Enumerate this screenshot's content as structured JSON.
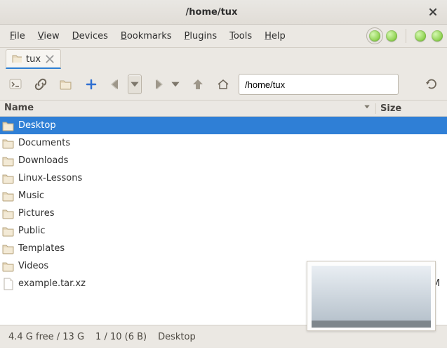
{
  "window": {
    "title": "/home/tux"
  },
  "menu": {
    "file": "File",
    "view": "View",
    "devices": "Devices",
    "bookmarks": "Bookmarks",
    "plugins": "Plugins",
    "tools": "Tools",
    "help": "Help"
  },
  "tab": {
    "label": "tux"
  },
  "path": {
    "value": "/home/tux"
  },
  "columns": {
    "name": "Name",
    "size": "Size"
  },
  "files": [
    {
      "name": "Desktop",
      "type": "folder",
      "size": "",
      "selected": true
    },
    {
      "name": "Documents",
      "type": "folder",
      "size": "",
      "selected": false
    },
    {
      "name": "Downloads",
      "type": "folder",
      "size": "",
      "selected": false
    },
    {
      "name": "Linux-Lessons",
      "type": "folder",
      "size": "",
      "selected": false
    },
    {
      "name": "Music",
      "type": "folder",
      "size": "",
      "selected": false
    },
    {
      "name": "Pictures",
      "type": "folder",
      "size": "",
      "selected": false
    },
    {
      "name": "Public",
      "type": "folder",
      "size": "",
      "selected": false
    },
    {
      "name": "Templates",
      "type": "folder",
      "size": "",
      "selected": false
    },
    {
      "name": "Videos",
      "type": "folder",
      "size": "",
      "selected": false
    },
    {
      "name": "example.tar.xz",
      "type": "file",
      "size": "7.9 M",
      "selected": false
    }
  ],
  "status": {
    "disk": "4.4 G free / 13 G",
    "selection": "1 / 10 (6 B)",
    "target": "Desktop"
  }
}
